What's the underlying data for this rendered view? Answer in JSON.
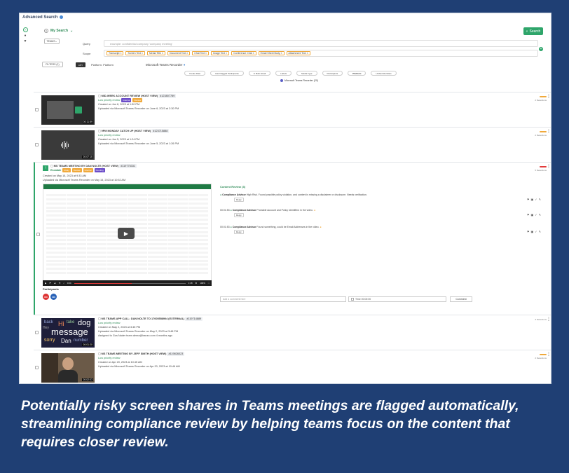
{
  "app": {
    "title": "Advanced Search"
  },
  "search": {
    "my_search_label": "My Search",
    "search_button": "Search",
    "platform_pill": "TEAMS",
    "query_label": "Query",
    "query_placeholder": "example: confidential company 'company meeting'",
    "scope_label": "Scope",
    "scope_chips": [
      "Transcript",
      "Screen Text",
      "Media Title",
      "Document Text",
      "Chat Text",
      "Image Text",
      "Conference Chat",
      "Email Sheet Body",
      "Attachment Text"
    ],
    "filters_label": "FILTERS (1)",
    "any_label": "ANY",
    "platform_label": "Platform: Platform",
    "platform_value": "Microsoft Teams Recorder",
    "filter_chips": [
      "Create Date",
      "Has Flagged Participants",
      "In Bulk Email",
      "Labels",
      "Media Type",
      "Participants",
      "Platform",
      "Unified Identities"
    ],
    "active_filter_tag": "Microsoft Teams Recorder (20)"
  },
  "results": [
    {
      "title": "MID-WEEK ACCOUNT REVIEW (HOST VIEW)",
      "id": "#123807789",
      "priority": "Low priority review",
      "tags": [
        "Internal",
        "Review"
      ],
      "created": "Created on Jun 6, 2023 at 1:30 PM",
      "uploaded": "Uploaded via Microsoft Teams Recorder on June 6, 2023 at 2:30 PM",
      "duration": "00:11:59",
      "detections": "2 Detections"
    },
    {
      "title": "9PM MONDAY CATCH UP (HOST VIEW)",
      "id": "#123715888",
      "priority": "Low priority review",
      "tags": [],
      "created": "Created on Jun 5, 2023 at 1:24 PM",
      "uploaded": "Uploaded via Microsoft Teams Recorder on June 5, 2023 at 1:26 PM",
      "duration": "00:07:15",
      "detections": "2 Detections"
    },
    {
      "title": "MS TEAMS MEETING BY DAN NOLTE (HOST VIEW)",
      "id": "#119775331",
      "priority": "Escalate",
      "tags": [
        "Risky",
        "Review",
        "Internal",
        "Pending"
      ],
      "created": "Created on May 15, 2023 at 9:33 AM",
      "uploaded": "Uploaded via Microsoft Teams Recorder on May 15, 2023 at 10:52 AM",
      "detections": "5 Detections",
      "player": {
        "time": "0:24",
        "length": "1:18",
        "zoom": "100%"
      },
      "content_review": {
        "title": "Content Review (3)",
        "items": [
          {
            "time": "",
            "advisor": "Compliance Advisor",
            "text": "High Risk. Found possible policy violation, and content is missing a disclaimer or disclosure. Needs verification.",
            "reply": "Reply"
          },
          {
            "time": "00:01:53",
            "advisor": "Compliance Advisor",
            "text": "Probable Account and Policy Identifiers in the video.",
            "reply": "Reply"
          },
          {
            "time": "00:01:53",
            "advisor": "Compliance Advisor",
            "text": "Found something, could be Email Addresses in the video.",
            "reply": "Reply"
          }
        ]
      },
      "comment_placeholder": "Add a comment here",
      "time_value": "Time 00:00:00",
      "comment_button": "Comment",
      "participants_label": "Participants",
      "participants": [
        "DN",
        "DN"
      ]
    },
    {
      "title": "MS TEAMS APP CALL: DAN NOLTE TO 17005558904 (EXTERNAL)",
      "id": "#119714889",
      "priority": "Low priority review",
      "tags": [],
      "created": "Created on May 2, 2023 at 3:45 PM",
      "uploaded": "Uploaded via Microsoft Teams Recorder on May 2, 2023 at 3:48 PM",
      "assigned": "Assigned to Gus Nader team demo@hanzo.com 4 months ago",
      "duration": "00:01:20",
      "detections": "3 Detections",
      "thumb_words": [
        "back",
        "Hi",
        "take",
        "dog",
        "Hey",
        "message",
        "sorry",
        "Dan",
        "number"
      ]
    },
    {
      "title": "MS TEAMS MEETING BY JEFF SMITH (HOST VIEW)",
      "id": "#119826023",
      "priority": "Low priority review",
      "tags": [],
      "created": "Created on Apr 20, 2023 at 10:45 AM",
      "uploaded": "Uploaded via Microsoft Teams Recorder on Apr 20, 2023 at 10:46 AM",
      "duration": "00:02:03",
      "detections": "2 Detections"
    }
  ],
  "caption": "Potentially risky screen shares in Teams meetings are flagged automatically, streamlining compliance review by helping teams focus on the content that requires closer review.",
  "colors": {
    "background": "#1f3f74",
    "accent": "#2ea56a",
    "warning": "#f0a93b",
    "danger": "#e23b3b"
  },
  "icons": {
    "search": "search-icon",
    "plus": "plus-icon",
    "kebab": "more-vertical-icon",
    "play": "play-icon",
    "settings": "gear-icon"
  }
}
